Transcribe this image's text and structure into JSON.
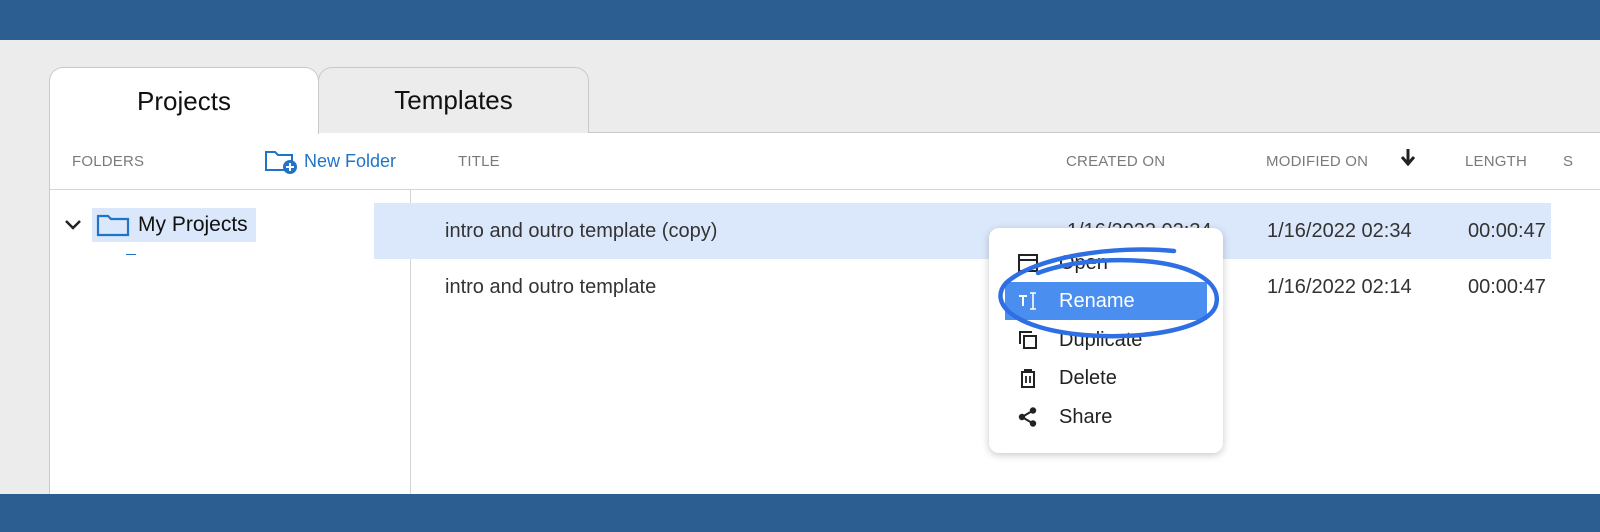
{
  "tabs": {
    "projects": "Projects",
    "templates": "Templates"
  },
  "header": {
    "folders": "FOLDERS",
    "new_folder": "New Folder",
    "title": "TITLE",
    "created_on": "CREATED ON",
    "modified_on": "MODIFIED ON",
    "length": "LENGTH",
    "extra": "S"
  },
  "folders": {
    "root": "My Projects"
  },
  "rows": [
    {
      "title": "intro and outro template (copy)",
      "created": "1/16/2022 02:34",
      "modified": "1/16/2022 02:34",
      "length": "00:00:47"
    },
    {
      "title": "intro and outro template",
      "created": "",
      "modified": "1/16/2022 02:14",
      "length": "00:00:47"
    }
  ],
  "context_menu": {
    "open": "Open",
    "rename": "Rename",
    "duplicate": "Duplicate",
    "delete": "Delete",
    "share": "Share"
  },
  "colors": {
    "band": "#2c5e91",
    "accent": "#1f74c7",
    "selection": "#dbe8fb",
    "menu_active": "#4a8ef0",
    "annotation": "#2f6fe4"
  },
  "icons": [
    "new-folder-icon",
    "chevron-down-icon",
    "folder-icon",
    "sort-down-arrow-icon",
    "open-icon",
    "rename-icon",
    "duplicate-icon",
    "trash-icon",
    "share-icon"
  ]
}
